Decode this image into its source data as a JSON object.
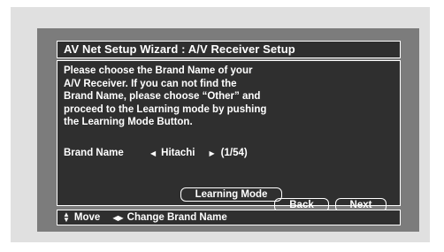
{
  "window": {
    "title": "AV Net Setup Wizard : A/V Receiver Setup"
  },
  "instructions": "Please choose the Brand Name of your\nA/V Receiver. If you can not find the\nBrand Name, please choose “Other” and\nproceed to the Learning mode by pushing\nthe Learning Mode Button.",
  "brand": {
    "label": "Brand Name",
    "value": "Hitachi",
    "position": "(1/54)"
  },
  "buttons": {
    "learning_mode": "Learning Mode",
    "back": "Back",
    "next": "Next"
  },
  "status_bar": {
    "move_label": "Move",
    "change_label": "Change Brand Name"
  },
  "icons": {
    "updown": "up-down-arrow-icon",
    "leftright": "left-right-arrow-icon"
  },
  "colors": {
    "panel": "#2f2f2f",
    "background": "#7c7c7c",
    "text": "#ffffff"
  }
}
